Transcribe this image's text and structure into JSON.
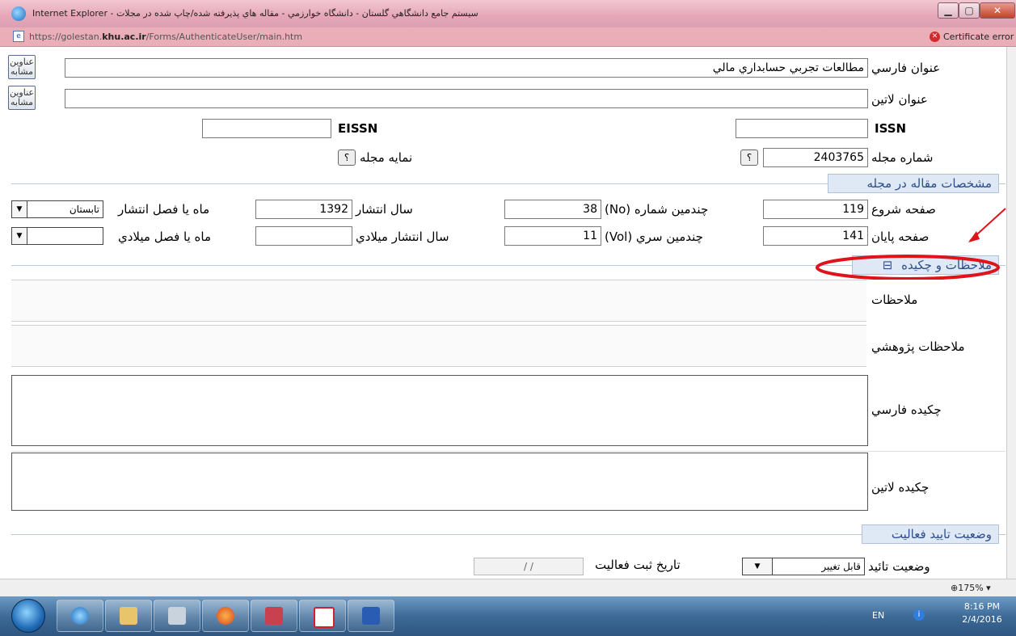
{
  "window": {
    "title": "سيستم جامع دانشگاهي گلستان - دانشگاه خوارزمي - مقاله هاي پذيرفته شده/چاپ شده در مجلات - Internet Explorer",
    "url_prefix": "https://golestan.",
    "url_domain": "khu.ac.ir",
    "url_path": "/Forms/AuthenticateUser/main.htm",
    "cert_error": "Certificate error"
  },
  "form": {
    "title_fa_label": "عنوان فارسي",
    "title_fa_value": "مطالعات تجربي حسابداري مالي",
    "title_latin_label": "عنوان لاتين",
    "title_latin_value": "",
    "issn_label": "ISSN",
    "issn_value": "",
    "eissn_label": "EISSN",
    "eissn_value": "",
    "journal_no_label": "شماره مجله",
    "journal_no_value": "2403765",
    "journal_index_label": "نمايه مجله",
    "help_glyph": "؟",
    "lookup_btn_line1": "عناوين",
    "lookup_btn_line2": "مشابه",
    "article_section_title": "مشخصات مقاله در مجله",
    "start_page_label": "صفحه شروع",
    "start_page_value": "119",
    "end_page_label": "صفحه پايان",
    "end_page_value": "141",
    "issue_no_label": "چندمين شماره (No)",
    "issue_no_value": "38",
    "volume_label": "چندمين سري (Vol)",
    "volume_value": "11",
    "pub_year_label": "سال انتشار",
    "pub_year_value": "1392",
    "pub_year_g_label": "سال انتشار ميلادي",
    "pub_year_g_value": "",
    "pub_season_label": "ماه يا فصل انتشار",
    "pub_season_value": "تابستان",
    "pub_season_g_label": "ماه يا فصل ميلادي",
    "pub_season_g_value": "",
    "notes_section_title": "ملاحظات و چكيده",
    "collapse_glyph": "⊟",
    "notes_label": "ملاحظات",
    "research_notes_label": "ملاحظات پژوهشي",
    "abstract_fa_label": "چكيده فارسي",
    "abstract_latin_label": "چكيده لاتين",
    "approval_section_title": "وضعيت تاييد فعاليت",
    "approval_status_label": "وضعيت تائيد",
    "approval_status_value": "قابل تغيير",
    "register_date_label": "تاريخ ثبت فعاليت",
    "register_date_value": "/ /"
  },
  "status": {
    "zoom": "175%"
  },
  "taskbar": {
    "lang": "EN",
    "time": "8:16 PM",
    "date": "2/4/2016"
  },
  "colors": {
    "title_pink": "#e6a6b8",
    "section_blue": "#2d4e8a",
    "annotation_red": "#e0121a"
  }
}
